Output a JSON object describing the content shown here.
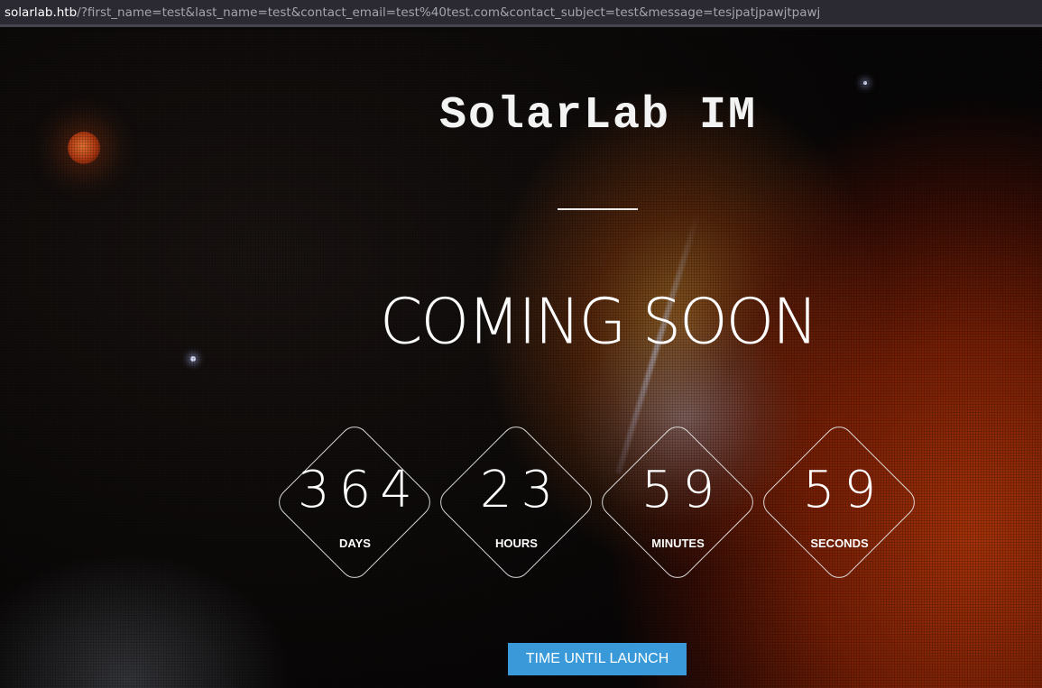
{
  "browser": {
    "url_host": "solarlab.htb",
    "url_rest": "/?first_name=test&last_name=test&contact_email=test%40test.com&contact_subject=test&message=tesjpatjpawjtpawj"
  },
  "page": {
    "title": "SolarLab IM",
    "headline": "COMING SOON",
    "countdown": [
      {
        "value": "364",
        "label": "DAYS"
      },
      {
        "value": "23",
        "label": "HOURS"
      },
      {
        "value": "59",
        "label": "MINUTES"
      },
      {
        "value": "59",
        "label": "SECONDS"
      }
    ],
    "launch_button": "TIME UNTIL LAUNCH"
  },
  "colors": {
    "accent_button": "#3a9ad9",
    "url_host": "#ffffff",
    "url_rest": "#a4a4ad"
  }
}
